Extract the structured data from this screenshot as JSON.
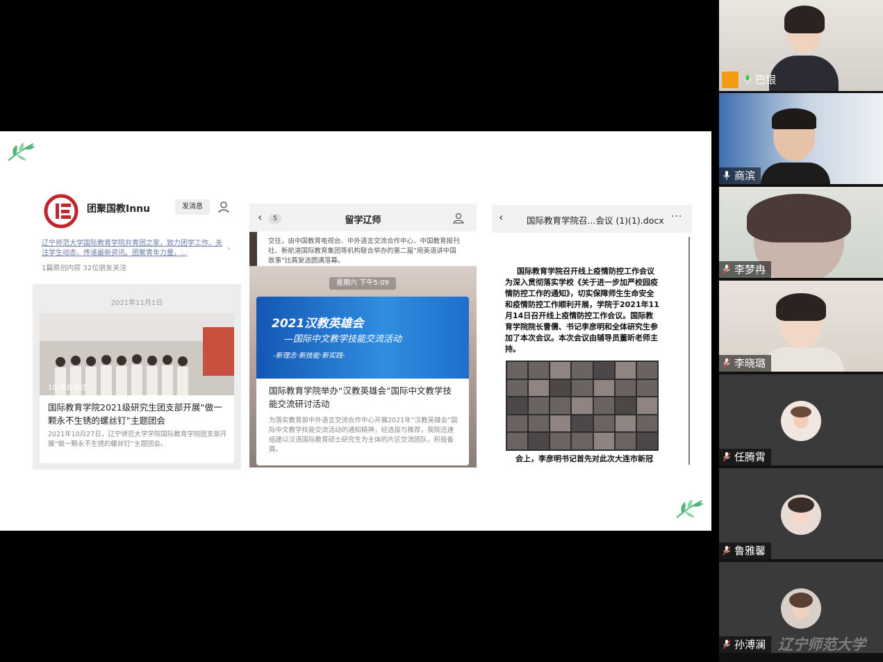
{
  "panel1": {
    "account_name": "团聚国教Innu",
    "send_message_button": "发消息",
    "description": "辽宁师范大学国际教育学院共青团之家，致力团学工作、关注学生动态、传递最新资讯。团聚青年力量，...",
    "stats": "1篇原创内容    32位朋友关注",
    "date": "2021年11月1日",
    "friends_read": "1位朋友读过",
    "article_title": "国际教育学院2021级研究生团支部开展“做一颗永不生锈的螺丝钉”主题团会",
    "article_summary": "2021年10月27日，辽宁师范大学学院国际教育学院团支部开展“做一颗永不生锈的螺丝钉”主题团会。"
  },
  "panel2": {
    "nav_back_count": "5",
    "nav_title": "留学辽师",
    "preview_text": "交往，由中国教育电视台、中外语言交流合作中心、中国教育报刊社、新航道国际教育集团等机构联合举办的第二届“用英语讲中国故事”比赛复选圆满落幕。",
    "timestamp": "星期六 下午5:09",
    "banner_title": "2021汉教英雄会",
    "banner_subtitle": "—国际中文教学技能交流活动",
    "banner_tagline": "-新理念·新技能·新实践-",
    "article_title": "国际教育学院举办“汉教英雄会”国际中文教学技能交流研讨活动",
    "article_summary": "为落实教育部中外语言交流合作中心开展2021年“汉教英雄会”国际中文教学技能交流活动的通知精神，经选拔与推荐，我院迅速组建以汉语国际教育硕士研究生为主体的片区交流团队，积极备赛。"
  },
  "panel3": {
    "nav_title": "国际教育学院召...会议 (1)(1).docx",
    "more_label": "···",
    "doc_title": "国际教育学院召开线上疫情防控工作会议",
    "doc_body": "为深入贯彻落实学校《关于进一步加严校园疫情防控工作的通知》，切实保障师生生命安全和疫情防控工作顺利开展，学院于2021年11月14日召开线上疫情防控工作会议。国际教育学院院长曹儒、书记李彦明和全体研究生参加了本次会议。本次会议由辅导员董昕老师主持。",
    "doc_footer": "会上，李彦明书记首先对此次大连市新冠"
  },
  "participants": [
    {
      "name": "巴银",
      "active": true,
      "muted": false
    },
    {
      "name": "商滨",
      "active": false,
      "muted": false
    },
    {
      "name": "李梦冉",
      "active": false,
      "muted": true
    },
    {
      "name": "李晓璐",
      "active": false,
      "muted": true
    },
    {
      "name": "任腾霄",
      "active": false,
      "muted": true
    },
    {
      "name": "鲁雅馨",
      "active": false,
      "muted": true
    },
    {
      "name": "孙溥澜",
      "active": false,
      "muted": true
    }
  ],
  "watermark": "辽宁师范大学",
  "colors": {
    "active_border": "#2ecc40",
    "muted_icon": "#e74c3c",
    "leaf": "#4fb37a"
  }
}
